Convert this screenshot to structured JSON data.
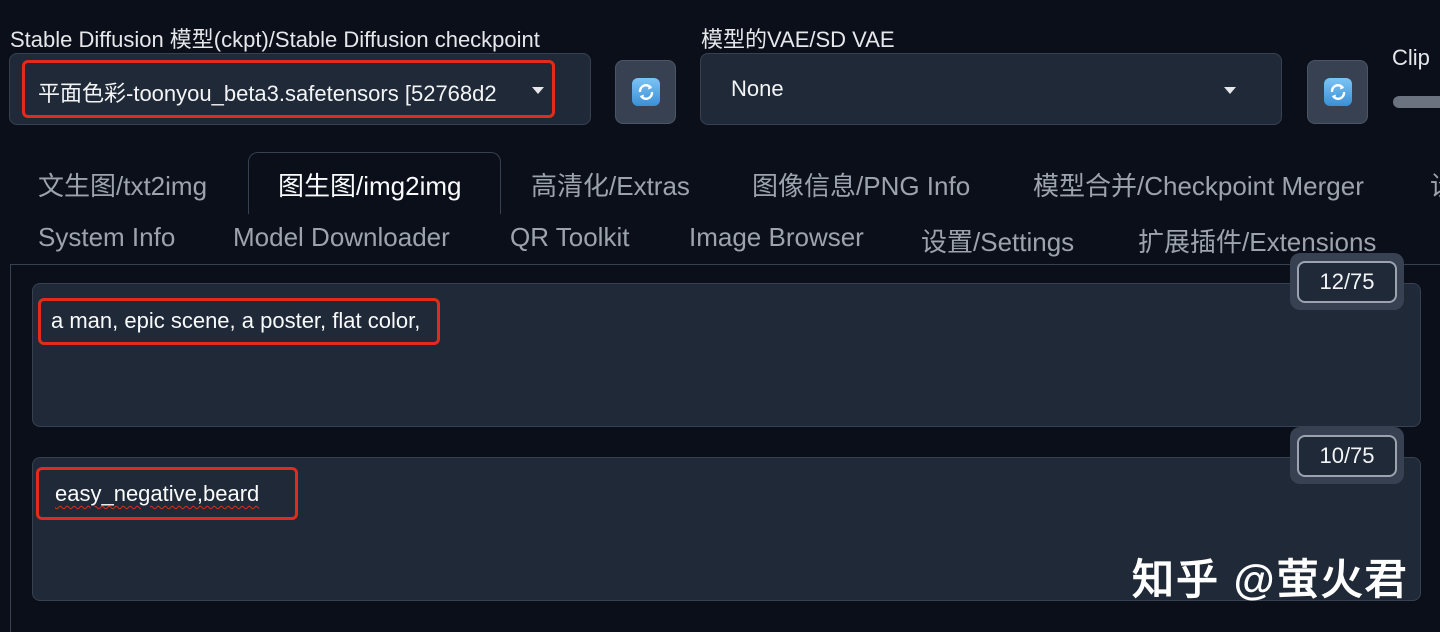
{
  "model": {
    "label": "Stable Diffusion 模型(ckpt)/Stable Diffusion checkpoint",
    "selected": "平面色彩-toonyou_beta3.safetensors [52768d2"
  },
  "vae": {
    "label": "模型的VAE/SD VAE",
    "selected": "None"
  },
  "clip": {
    "label": "Clip"
  },
  "tabs_row1": [
    {
      "label": "文生图/txt2img"
    },
    {
      "label": "图生图/img2img"
    },
    {
      "label": "高清化/Extras"
    },
    {
      "label": "图像信息/PNG Info"
    },
    {
      "label": "模型合并/Checkpoint Merger"
    },
    {
      "label": "设"
    }
  ],
  "tabs_row2": [
    {
      "label": "System Info"
    },
    {
      "label": "Model Downloader"
    },
    {
      "label": "QR Toolkit"
    },
    {
      "label": "Image Browser"
    },
    {
      "label": "设置/Settings"
    },
    {
      "label": "扩展插件/Extensions"
    }
  ],
  "active_tab": "图生图/img2img",
  "prompt": {
    "text": "a man, epic scene, a poster, flat color,",
    "token_count": "12/75"
  },
  "negative_prompt": {
    "text": "easy_negative,beard",
    "token_count": "10/75"
  },
  "watermark": "知乎 @萤火君",
  "icons": {
    "refresh": "refresh-icon",
    "dropdown": "chevron-down-icon"
  },
  "colors": {
    "background": "#0b0f19",
    "field": "#1f2937",
    "highlight": "#e12b1d"
  }
}
